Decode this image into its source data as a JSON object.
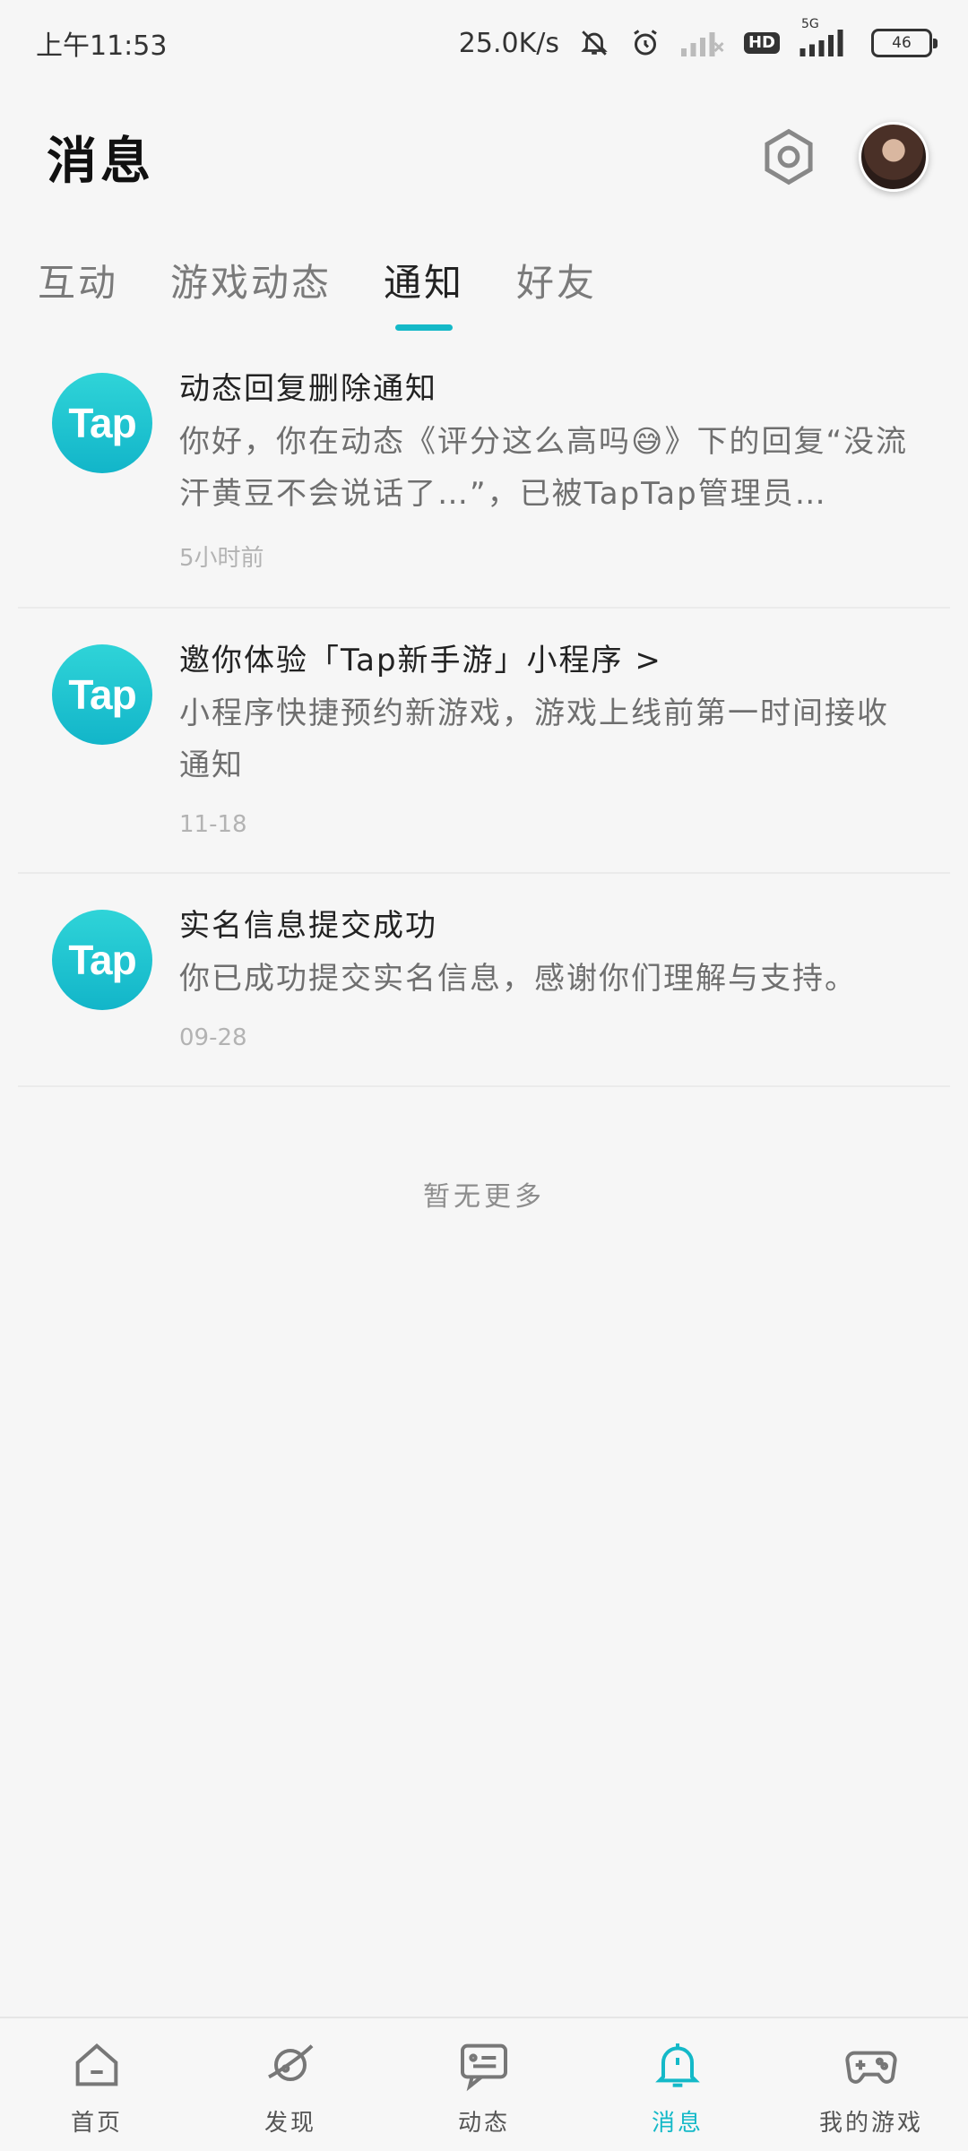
{
  "status_bar": {
    "time": "上午11:53",
    "net_speed": "25.0K/s",
    "hd_label": "HD",
    "network_type": "5G",
    "battery": "46"
  },
  "header": {
    "title": "消息"
  },
  "tabs": [
    {
      "label": "互动"
    },
    {
      "label": "游戏动态"
    },
    {
      "label": "通知"
    },
    {
      "label": "好友"
    }
  ],
  "active_tab": "通知",
  "notifications": [
    {
      "logo": "Tap",
      "title": "动态回复删除通知",
      "text": "你好，你在动态《评分这么高吗😅》下的回复“没流汗黄豆不会说话了…”，已被TapTap管理员…",
      "time": "5小时前"
    },
    {
      "logo": "Tap",
      "title": "邀你体验「Tap新手游」小程序 >",
      "text": "小程序快捷预约新游戏，游戏上线前第一时间接收通知",
      "time": "11-18"
    },
    {
      "logo": "Tap",
      "title": "实名信息提交成功",
      "text": "你已成功提交实名信息，感谢你们理解与支持。",
      "time": "09-28"
    }
  ],
  "no_more": "暂无更多",
  "bottom_nav": [
    {
      "label": "首页",
      "icon": "home-icon"
    },
    {
      "label": "发现",
      "icon": "planet-icon"
    },
    {
      "label": "动态",
      "icon": "message-card-icon"
    },
    {
      "label": "消息",
      "icon": "bell-icon"
    },
    {
      "label": "我的游戏",
      "icon": "gamepad-icon"
    }
  ],
  "colors": {
    "accent": "#14b9c8",
    "background": "#f6f6f6"
  }
}
